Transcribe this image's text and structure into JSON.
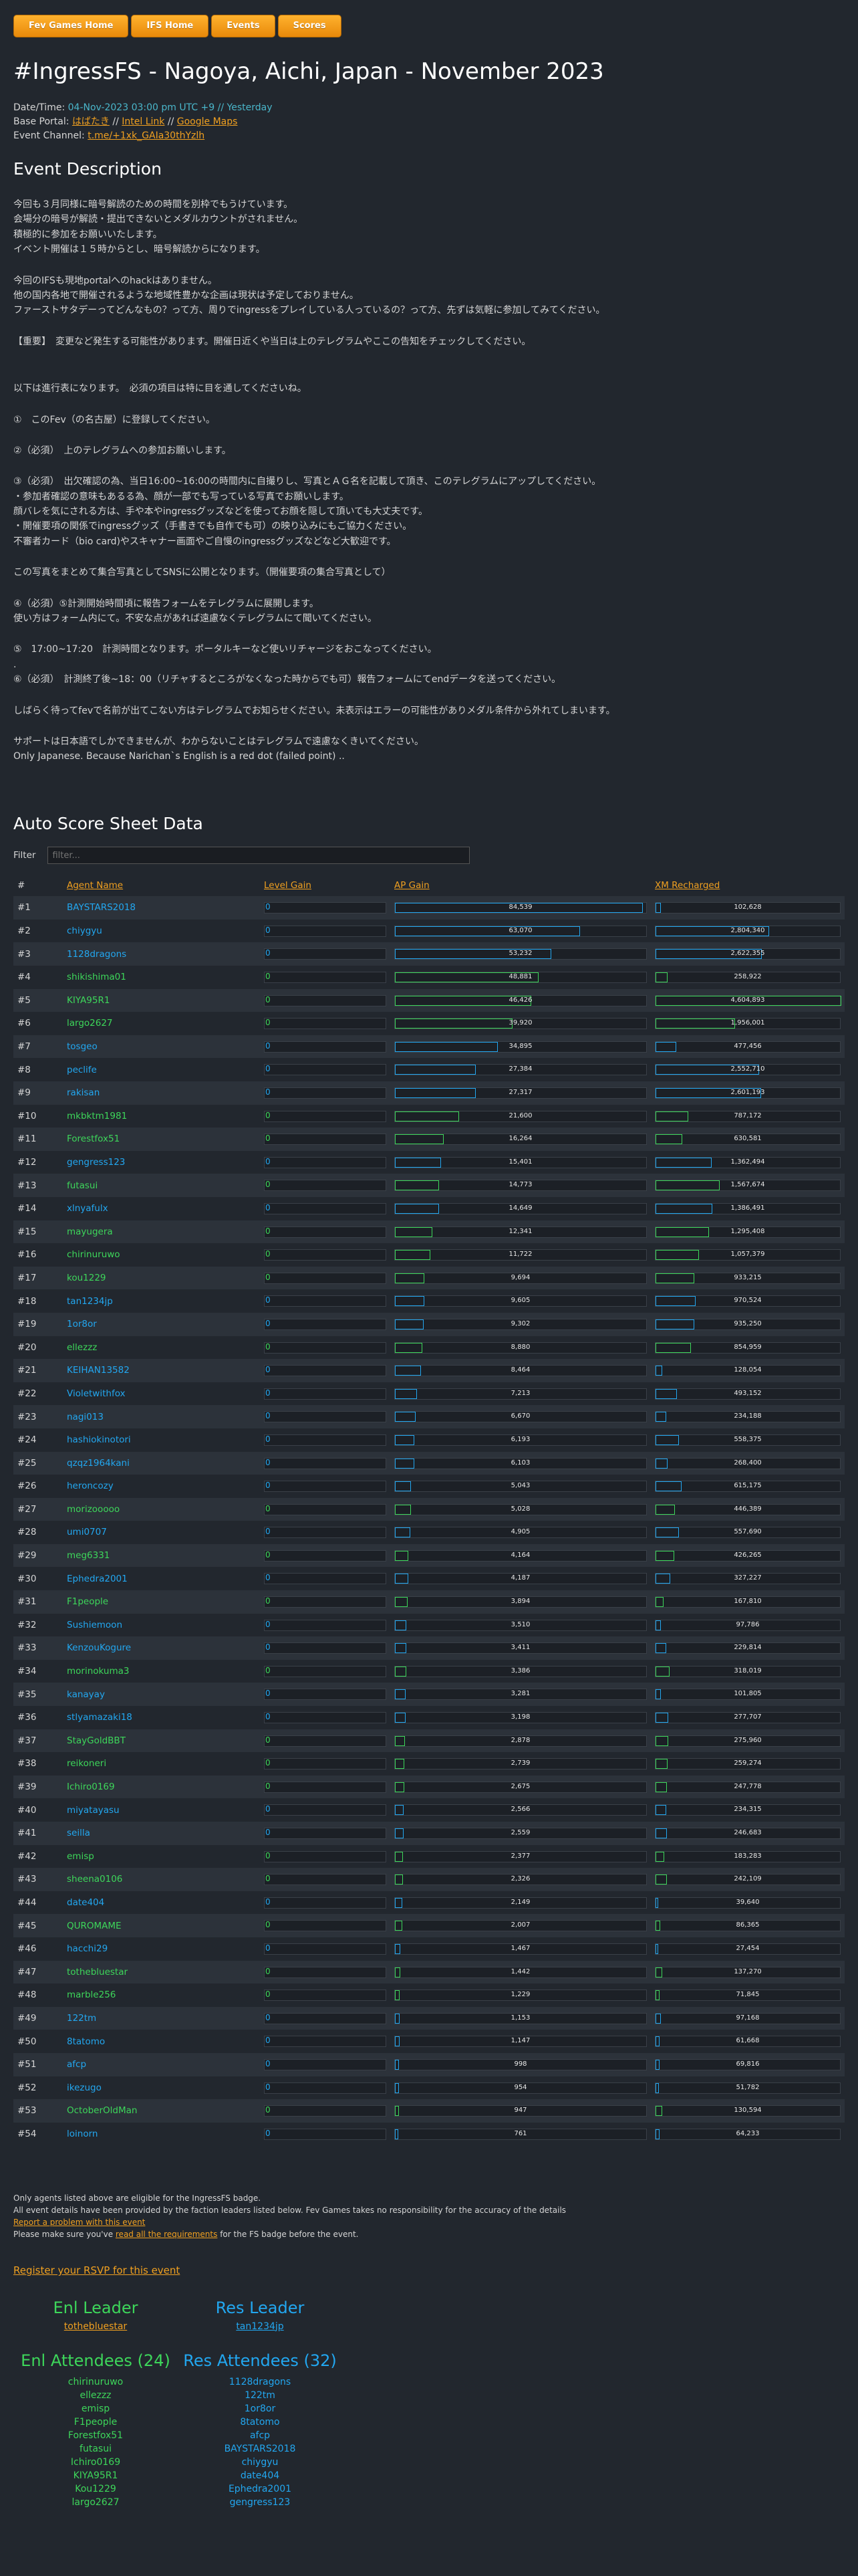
{
  "nav": [
    "Fev Games Home",
    "IFS Home",
    "Events",
    "Scores"
  ],
  "title": "#IngressFS - Nagoya, Aichi, Japan - November 2023",
  "datetime_label": "Date/Time:",
  "datetime_value": "04-Nov-2023 03:00 pm UTC +9 // Yesterday",
  "base_label": "Base Portal:",
  "base_portal": "はばたき",
  "base_sep1": "//",
  "intel_link": "Intel Link",
  "base_sep2": "//",
  "maps_link": "Google Maps",
  "channel_label": "Event Channel:",
  "channel_link": "t.me/+1xk_GAIa30thYzlh",
  "desc_title": "Event Description",
  "description": [
    "今回も３月同様に暗号解読のための時間を別枠でもうけています。",
    "会場分の暗号が解読・提出できないとメダルカウントがされません。",
    "積極的に参加をお願いいたします。",
    "イベント開催は１５時からとし、暗号解読からになります。",
    "",
    "今回のIFSも現地portalへのhackはありません。",
    "他の国内各地で開催されるような地域性豊かな企画は現状は予定しておりません。",
    "ファーストサタデーってどんなもの？って方、周りでingressをプレイしている人っているの？って方、先ずは気軽に参加してみてください。",
    "",
    "【重要】　変更など発生する可能性があります。開催日近くや当日は上のテレグラムやここの告知をチェックしてください。",
    "",
    "",
    "以下は進行表になります。　必須の項目は特に目を通してくださいね。",
    "",
    "①　このFev（の名古屋）に登録してください。",
    "",
    "②（必須）　上のテレグラムへの参加お願いします。",
    "",
    "③（必須）　出欠確認の為、当日16:00~16:00の時間内に自撮りし、写真とＡＧ名を記載して頂き、このテレグラムにアップしてください。",
    "・参加者確認の意味もあるる為、顔が一部でも写っている写真でお願いします。",
    "顔バレを気にされる方は、手や本やingressグッズなどを使ってお顔を隠して頂いても大丈夫です。",
    "・開催要項の関係でingressグッズ（手書きでも自作でも可）の映り込みにもご協力ください。",
    "不審者カード（bio card)やスキャナー画面やご自慢のingressグッズなどなど大歓迎です。",
    "",
    "この写真をまとめて集合写真としてSNSに公開となります。（開催要項の集合写真として）",
    "",
    "④（必須）⑤計測開始時間頃に報告フォームをテレグラムに展開します。",
    "使い方はフォーム内にて。不安な点があれば遠慮なくテレグラムにて聞いてください。",
    "",
    "⑤　17:00~17:20　計測時間となります。ポータルキーなど使いリチャージをおこなってください。",
    ".",
    "⑥（必須）　計測終了後~18：00（リチャするところがなくなった時からでも可）報告フォームにてendデータを送ってください。",
    "",
    "しばらく待ってfevで名前が出てこない方はテレグラムでお知らせください。未表示はエラーの可能性がありメダル条件から外れてしまいます。",
    "",
    "サポートは日本語でしかできませんが、わからないことはテレグラムで遠慮なくきいてください。",
    "Only Japanese. Because Narichan`s English is a red dot (failed point) .."
  ],
  "score_title": "Auto Score Sheet Data",
  "filter_label": "Filter",
  "filter_placeholder": "filter...",
  "columns": [
    "#",
    "Agent Name",
    "Level Gain",
    "AP Gain",
    "XM Recharged"
  ],
  "rows": [
    {
      "rank": "#1",
      "agent": "BAYSTARS2018",
      "faction": "res",
      "level": "0",
      "ap": 84539,
      "xm": 102628
    },
    {
      "rank": "#2",
      "agent": "chiygyu",
      "faction": "res",
      "level": "0",
      "ap": 63070,
      "xm": 2804340
    },
    {
      "rank": "#3",
      "agent": "1128dragons",
      "faction": "res",
      "level": "0",
      "ap": 53232,
      "xm": 2622355
    },
    {
      "rank": "#4",
      "agent": "shikishima01",
      "faction": "enl",
      "level": "0",
      "ap": 48881,
      "xm": 258922
    },
    {
      "rank": "#5",
      "agent": "KIYA95R1",
      "faction": "enl",
      "level": "0",
      "ap": 46426,
      "xm": 4604893
    },
    {
      "rank": "#6",
      "agent": "largo2627",
      "faction": "enl",
      "level": "0",
      "ap": 39920,
      "xm": 1956001
    },
    {
      "rank": "#7",
      "agent": "tosgeo",
      "faction": "res",
      "level": "0",
      "ap": 34895,
      "xm": 477456
    },
    {
      "rank": "#8",
      "agent": "peclife",
      "faction": "res",
      "level": "0",
      "ap": 27384,
      "xm": 2552710
    },
    {
      "rank": "#9",
      "agent": "rakisan",
      "faction": "res",
      "level": "0",
      "ap": 27317,
      "xm": 2601193
    },
    {
      "rank": "#10",
      "agent": "mkbktm1981",
      "faction": "enl",
      "level": "0",
      "ap": 21600,
      "xm": 787172
    },
    {
      "rank": "#11",
      "agent": "Forestfox51",
      "faction": "enl",
      "level": "0",
      "ap": 16264,
      "xm": 630581
    },
    {
      "rank": "#12",
      "agent": "gengress123",
      "faction": "res",
      "level": "0",
      "ap": 15401,
      "xm": 1362494
    },
    {
      "rank": "#13",
      "agent": "futasui",
      "faction": "enl",
      "level": "0",
      "ap": 14773,
      "xm": 1567674
    },
    {
      "rank": "#14",
      "agent": "xlnyafulx",
      "faction": "res",
      "level": "0",
      "ap": 14649,
      "xm": 1386491
    },
    {
      "rank": "#15",
      "agent": "mayugera",
      "faction": "enl",
      "level": "0",
      "ap": 12341,
      "xm": 1295408
    },
    {
      "rank": "#16",
      "agent": "chirinuruwo",
      "faction": "enl",
      "level": "0",
      "ap": 11722,
      "xm": 1057379
    },
    {
      "rank": "#17",
      "agent": "kou1229",
      "faction": "enl",
      "level": "0",
      "ap": 9694,
      "xm": 933215
    },
    {
      "rank": "#18",
      "agent": "tan1234jp",
      "faction": "res",
      "level": "0",
      "ap": 9605,
      "xm": 970524
    },
    {
      "rank": "#19",
      "agent": "1or8or",
      "faction": "res",
      "level": "0",
      "ap": 9302,
      "xm": 935250
    },
    {
      "rank": "#20",
      "agent": "ellezzz",
      "faction": "enl",
      "level": "0",
      "ap": 8880,
      "xm": 854959
    },
    {
      "rank": "#21",
      "agent": "KEIHAN13582",
      "faction": "res",
      "level": "0",
      "ap": 8464,
      "xm": 128054
    },
    {
      "rank": "#22",
      "agent": "Violetwithfox",
      "faction": "res",
      "level": "0",
      "ap": 7213,
      "xm": 493152
    },
    {
      "rank": "#23",
      "agent": "nagi013",
      "faction": "res",
      "level": "0",
      "ap": 6670,
      "xm": 234188
    },
    {
      "rank": "#24",
      "agent": "hashiokinotori",
      "faction": "res",
      "level": "0",
      "ap": 6193,
      "xm": 558375
    },
    {
      "rank": "#25",
      "agent": "qzqz1964kani",
      "faction": "res",
      "level": "0",
      "ap": 6103,
      "xm": 268400
    },
    {
      "rank": "#26",
      "agent": "heroncozy",
      "faction": "res",
      "level": "0",
      "ap": 5043,
      "xm": 615175
    },
    {
      "rank": "#27",
      "agent": "morizooooo",
      "faction": "enl",
      "level": "0",
      "ap": 5028,
      "xm": 446389
    },
    {
      "rank": "#28",
      "agent": "umi0707",
      "faction": "res",
      "level": "0",
      "ap": 4905,
      "xm": 557690
    },
    {
      "rank": "#29",
      "agent": "meg6331",
      "faction": "enl",
      "level": "0",
      "ap": 4164,
      "xm": 426265
    },
    {
      "rank": "#30",
      "agent": "Ephedra2001",
      "faction": "res",
      "level": "0",
      "ap": 4187,
      "xm": 327227
    },
    {
      "rank": "#31",
      "agent": "F1people",
      "faction": "enl",
      "level": "0",
      "ap": 3894,
      "xm": 167810
    },
    {
      "rank": "#32",
      "agent": "Sushiemoon",
      "faction": "res",
      "level": "0",
      "ap": 3510,
      "xm": 97786
    },
    {
      "rank": "#33",
      "agent": "KenzouKogure",
      "faction": "res",
      "level": "0",
      "ap": 3411,
      "xm": 229814
    },
    {
      "rank": "#34",
      "agent": "morinokuma3",
      "faction": "enl",
      "level": "0",
      "ap": 3386,
      "xm": 318019
    },
    {
      "rank": "#35",
      "agent": "kanayay",
      "faction": "res",
      "level": "0",
      "ap": 3281,
      "xm": 101805
    },
    {
      "rank": "#36",
      "agent": "stlyamazaki18",
      "faction": "res",
      "level": "0",
      "ap": 3198,
      "xm": 277707
    },
    {
      "rank": "#37",
      "agent": "StayGoldBBT",
      "faction": "enl",
      "level": "0",
      "ap": 2878,
      "xm": 275960
    },
    {
      "rank": "#38",
      "agent": "reikoneri",
      "faction": "enl",
      "level": "0",
      "ap": 2739,
      "xm": 259274
    },
    {
      "rank": "#39",
      "agent": "Ichiro0169",
      "faction": "enl",
      "level": "0",
      "ap": 2675,
      "xm": 247778
    },
    {
      "rank": "#40",
      "agent": "miyatayasu",
      "faction": "res",
      "level": "0",
      "ap": 2566,
      "xm": 234315
    },
    {
      "rank": "#41",
      "agent": "seilla",
      "faction": "res",
      "level": "0",
      "ap": 2559,
      "xm": 246683
    },
    {
      "rank": "#42",
      "agent": "emisp",
      "faction": "enl",
      "level": "0",
      "ap": 2377,
      "xm": 183283
    },
    {
      "rank": "#43",
      "agent": "sheena0106",
      "faction": "enl",
      "level": "0",
      "ap": 2326,
      "xm": 242109
    },
    {
      "rank": "#44",
      "agent": "date404",
      "faction": "res",
      "level": "0",
      "ap": 2149,
      "xm": 39640
    },
    {
      "rank": "#45",
      "agent": "QUROMAME",
      "faction": "enl",
      "level": "0",
      "ap": 2007,
      "xm": 86365
    },
    {
      "rank": "#46",
      "agent": "hacchi29",
      "faction": "res",
      "level": "0",
      "ap": 1467,
      "xm": 27454
    },
    {
      "rank": "#47",
      "agent": "tothebluestar",
      "faction": "enl",
      "level": "0",
      "ap": 1442,
      "xm": 137270
    },
    {
      "rank": "#48",
      "agent": "marble256",
      "faction": "enl",
      "level": "0",
      "ap": 1229,
      "xm": 71845
    },
    {
      "rank": "#49",
      "agent": "122tm",
      "faction": "res",
      "level": "0",
      "ap": 1153,
      "xm": 97168
    },
    {
      "rank": "#50",
      "agent": "8tatomo",
      "faction": "res",
      "level": "0",
      "ap": 1147,
      "xm": 61668
    },
    {
      "rank": "#51",
      "agent": "afcp",
      "faction": "res",
      "level": "0",
      "ap": 998,
      "xm": 69816
    },
    {
      "rank": "#52",
      "agent": "ikezugo",
      "faction": "res",
      "level": "0",
      "ap": 954,
      "xm": 51782
    },
    {
      "rank": "#53",
      "agent": "OctoberOldMan",
      "faction": "enl",
      "level": "0",
      "ap": 947,
      "xm": 130594
    },
    {
      "rank": "#54",
      "agent": "loinorn",
      "faction": "res",
      "level": "0",
      "ap": 761,
      "xm": 64233
    }
  ],
  "footer": {
    "line1": "Only agents listed above are eligible for the IngressFS badge.",
    "line2": "All event details have been provided by the faction leaders listed below. Fev Games takes no responsibility for the accuracy of the details",
    "report_link": "Report a problem with this event",
    "line4_pre": "Please make sure you've ",
    "line4_link": "read all the requirements",
    "line4_post": " for the FS badge before the event."
  },
  "rsvp": "Register your RSVP for this event",
  "enl_leader_title": "Enl Leader",
  "enl_leader": "tothebluestar",
  "res_leader_title": "Res Leader",
  "res_leader": "tan1234jp",
  "enl_att_title": "Enl Attendees (24)",
  "res_att_title": "Res Attendees (32)",
  "enl_attendees": [
    "chirinuruwo",
    "ellezzz",
    "emisp",
    "F1people",
    "Forestfox51",
    "futasui",
    "Ichiro0169",
    "KIYA95R1",
    "Kou1229",
    "largo2627"
  ],
  "res_attendees": [
    "1128dragons",
    "122tm",
    "1or8or",
    "8tatomo",
    "afcp",
    "BAYSTARS2018",
    "chiygyu",
    "date404",
    "Ephedra2001",
    "gengress123"
  ],
  "colors": {
    "enl": "#3dd65a",
    "res": "#22a7f0",
    "accent": "#f0a020",
    "teal": "#4ab6ca",
    "background": "#22272e"
  }
}
